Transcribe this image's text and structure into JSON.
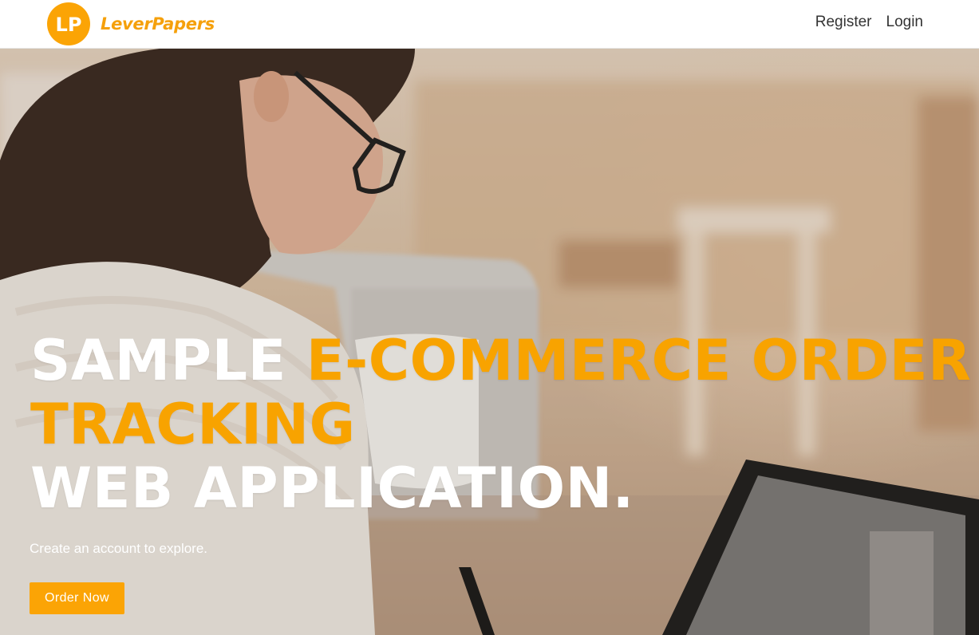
{
  "brand": {
    "logo_mark": "LP",
    "name": "LeverPapers",
    "color": "#fba405"
  },
  "nav": {
    "register": "Register",
    "login": "Login"
  },
  "hero": {
    "headline_part1": "SAMPLE ",
    "headline_part2": "E-COMMERCE ORDER",
    "headline_part3": "TRACKING",
    "headline_part4": "WEB APPLICATION.",
    "subtitle": "Create an account to explore.",
    "cta_label": "Order Now",
    "accent_color": "#f8a300"
  }
}
